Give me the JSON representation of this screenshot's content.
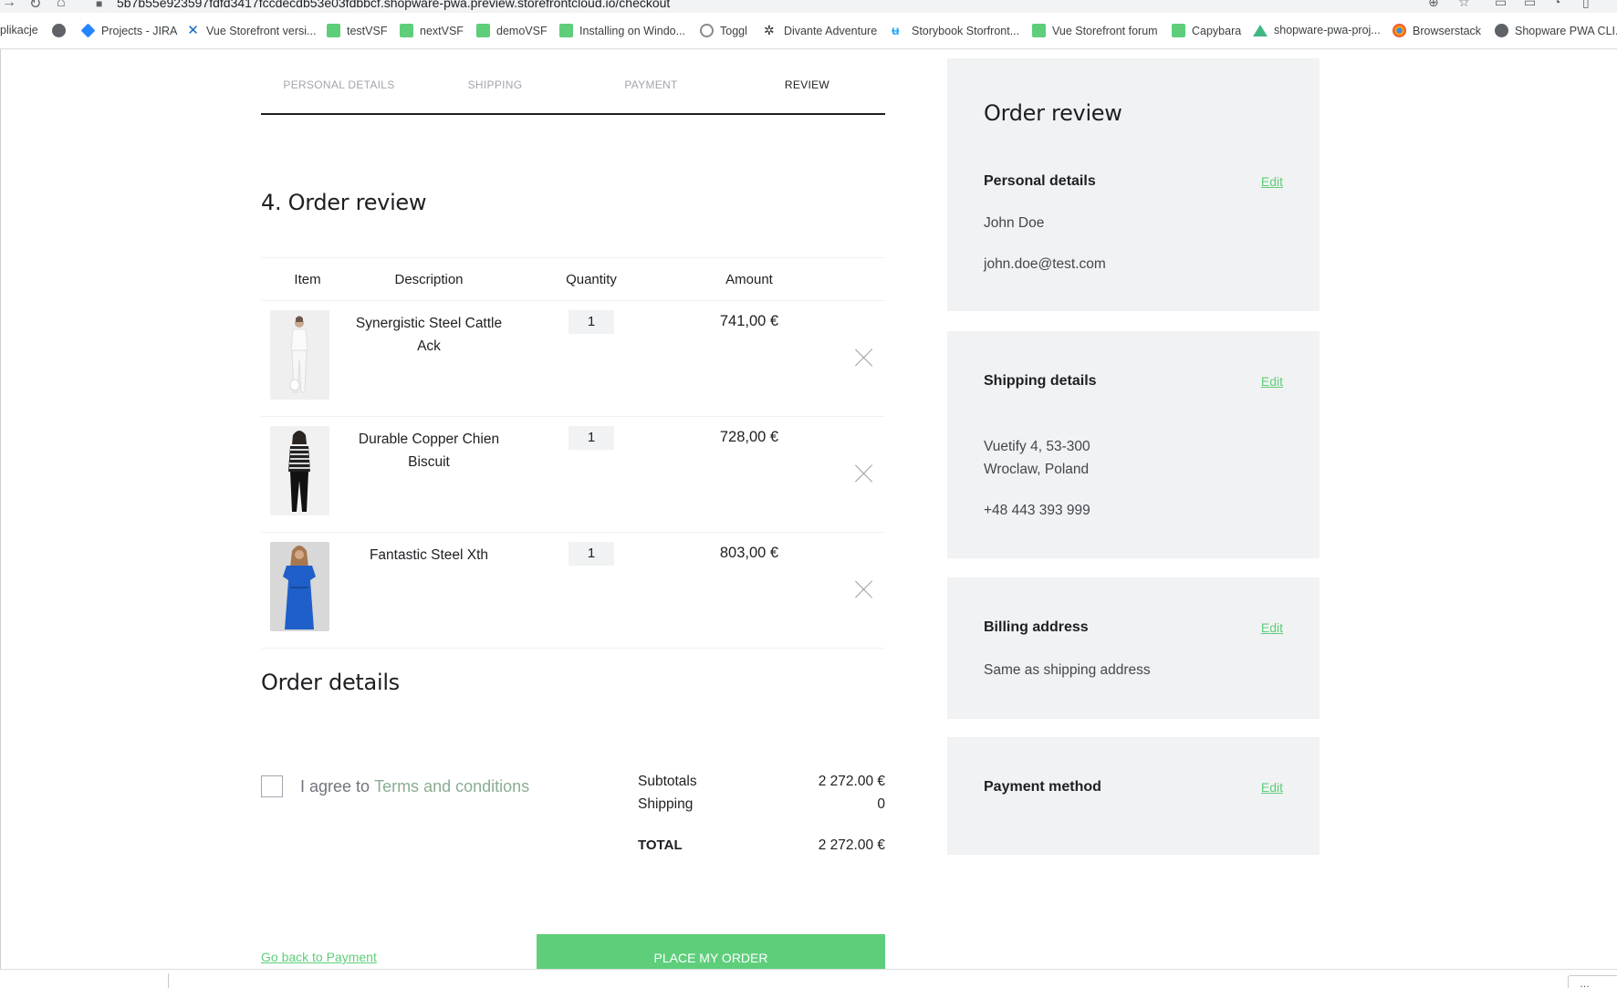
{
  "browser": {
    "url": "5b7b55e923597fdfd3417fccdecdb53e03fdbbcf.shopware-pwa.preview.storefrontcloud.io/checkout",
    "bookmarks": [
      {
        "label": "plikacje",
        "icon": "apps-icon"
      },
      {
        "label": "",
        "icon": "globe-icon"
      },
      {
        "label": "Projects - JIRA",
        "icon": "jira-icon"
      },
      {
        "label": "Vue Storefront versi...",
        "icon": "vue-storefront-icon"
      },
      {
        "label": "testVSF",
        "icon": "green-page-icon"
      },
      {
        "label": "nextVSF",
        "icon": "green-page-icon"
      },
      {
        "label": "demoVSF",
        "icon": "green-page-icon"
      },
      {
        "label": "Installing on Windo...",
        "icon": "green-page-icon"
      },
      {
        "label": "Toggl",
        "icon": "toggl-icon"
      },
      {
        "label": "Divante Adventure",
        "icon": "divante-icon"
      },
      {
        "label": "Storybook Storfront...",
        "icon": "storybook-icon"
      },
      {
        "label": "Vue Storefront forum",
        "icon": "green-page-icon"
      },
      {
        "label": "Capybara",
        "icon": "green-page-icon"
      },
      {
        "label": "shopware-pwa-proj...",
        "icon": "vue-triangle-icon"
      },
      {
        "label": "Browserstack",
        "icon": "browserstack-icon"
      },
      {
        "label": "Shopware PWA CLI...",
        "icon": "globe-icon"
      }
    ]
  },
  "steps": [
    {
      "label": "PERSONAL DETAILS",
      "active": false
    },
    {
      "label": "SHIPPING",
      "active": false
    },
    {
      "label": "PAYMENT",
      "active": false
    },
    {
      "label": "REVIEW",
      "active": true
    }
  ],
  "review": {
    "heading": "4. Order review",
    "columns": {
      "item": "Item",
      "description": "Description",
      "quantity": "Quantity",
      "amount": "Amount"
    },
    "items": [
      {
        "name": "Synergistic Steel Cattle Ack",
        "quantity": "1",
        "amount": "741,00 €",
        "image": "woman-white-outfit"
      },
      {
        "name": "Durable Copper Chien Biscuit",
        "quantity": "1",
        "amount": "728,00 €",
        "image": "woman-striped-top"
      },
      {
        "name": "Fantastic Steel Xth",
        "quantity": "1",
        "amount": "803,00 €",
        "image": "woman-blue-dress"
      }
    ]
  },
  "order_details": {
    "heading": "Order details",
    "agree_text": "I agree to",
    "terms_link": "Terms and conditions",
    "subtotal_label": "Subtotals",
    "subtotal_value": "2 272.00 €",
    "shipping_label": "Shipping",
    "shipping_value": "0",
    "total_label": "TOTAL",
    "total_value": "2 272.00 €",
    "back_link": "Go back to Payment",
    "place_order": "PLACE MY ORDER"
  },
  "sidebar": {
    "title": "Order review",
    "edit_label": "Edit",
    "personal": {
      "heading": "Personal details",
      "name": "John Doe",
      "email": "john.doe@test.com"
    },
    "shipping": {
      "heading": "Shipping details",
      "address_line1": "Vuetify 4, 53-300",
      "address_line2": "Wroclaw, Poland",
      "phone": "+48 443 393 999"
    },
    "billing": {
      "heading": "Billing address",
      "text": "Same as shipping address"
    },
    "payment": {
      "heading": "Payment method"
    }
  },
  "colors": {
    "primary": "#5ece7b",
    "panel": "#f1f2f3",
    "text": "#1d1f22"
  }
}
